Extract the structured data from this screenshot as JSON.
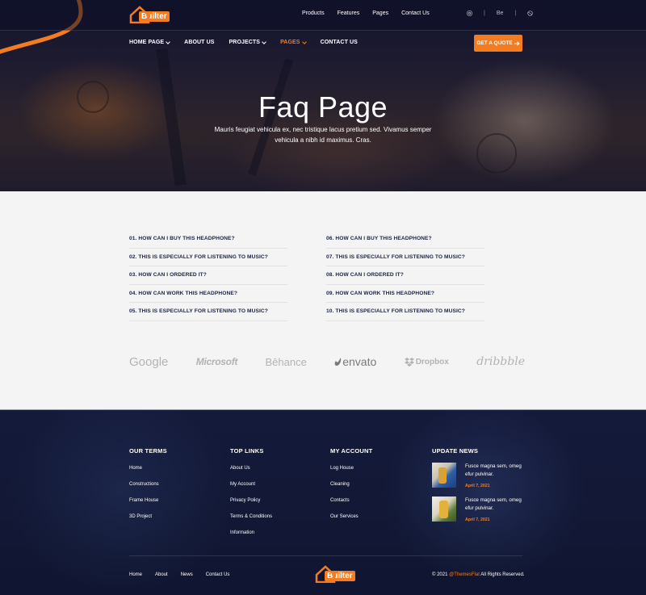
{
  "brand": {
    "name": "Builter",
    "accent": "#f47c20",
    "dark": "#101631"
  },
  "topbar": {
    "links": [
      "Products",
      "Features",
      "Pages",
      "Contact Us"
    ],
    "social": {
      "icon1": "instagram-icon",
      "behance": "Be",
      "icon3": "dribbble-icon"
    }
  },
  "nav": {
    "items": [
      {
        "label": "HOME PAGE",
        "dropdown": true
      },
      {
        "label": "ABOUT US",
        "dropdown": false
      },
      {
        "label": "PROJECTS",
        "dropdown": true
      },
      {
        "label": "PAGES",
        "dropdown": true,
        "active": true
      },
      {
        "label": "CONTACT US",
        "dropdown": false
      }
    ],
    "cta": "GET A QUOTE"
  },
  "hero": {
    "title": "Faq Page",
    "subtitle": "Mauris feugiat vehicula ex, nec tristique lacus pretium sed. Vivamus semper vehicula a nibh id maximus. Cras."
  },
  "faq": {
    "left": [
      "01. HOW CAN I BUY THIS HEADPHONE?",
      "02. THIS IS ESPECIALLY FOR LISTENING TO MUSIC?",
      "03. HOW CAN I ORDERED IT?",
      "04. HOW CAN WORK THIS HEADPHONE?",
      "05. THIS IS ESPECIALLY FOR LISTENING TO MUSIC?"
    ],
    "right": [
      "06. HOW CAN I BUY THIS HEADPHONE?",
      "07. THIS IS ESPECIALLY FOR LISTENING TO MUSIC?",
      "08. HOW CAN I ORDERED IT?",
      "09. HOW CAN WORK THIS HEADPHONE?",
      "10. THIS IS ESPECIALLY FOR LISTENING TO MUSIC?"
    ]
  },
  "brands": [
    "Google",
    "Microsoft",
    "Bēhance",
    "envato",
    "Dropbox",
    "dribbble"
  ],
  "footer": {
    "terms": {
      "title": "OUR TERMS",
      "links": [
        "Home",
        "Constructions",
        "Frame House",
        "3D Project"
      ]
    },
    "top": {
      "title": "TOP LINKS",
      "links": [
        "About Us",
        "My Account",
        "Privacy Policy",
        "Terms & Conditions",
        "Information"
      ]
    },
    "account": {
      "title": "MY ACCOUNT",
      "links": [
        "Log House",
        "Cleaning",
        "Contacts",
        "Our Services"
      ]
    },
    "news": {
      "title": "UPDATE NEWS",
      "items": [
        {
          "title": "Fusce magna sem, omeg efur pulvinar.",
          "date": "April 7, 2021"
        },
        {
          "title": "Fusce magna sem, omeg efur pulvinar.",
          "date": "April 7, 2021"
        }
      ]
    },
    "bottom_links": [
      "Home",
      "About",
      "News",
      "Contact Us"
    ],
    "copyright_prefix": "© 2021",
    "copyright_brand": "@ThemesFlat",
    "copyright_suffix": "All Rights Reserved."
  }
}
